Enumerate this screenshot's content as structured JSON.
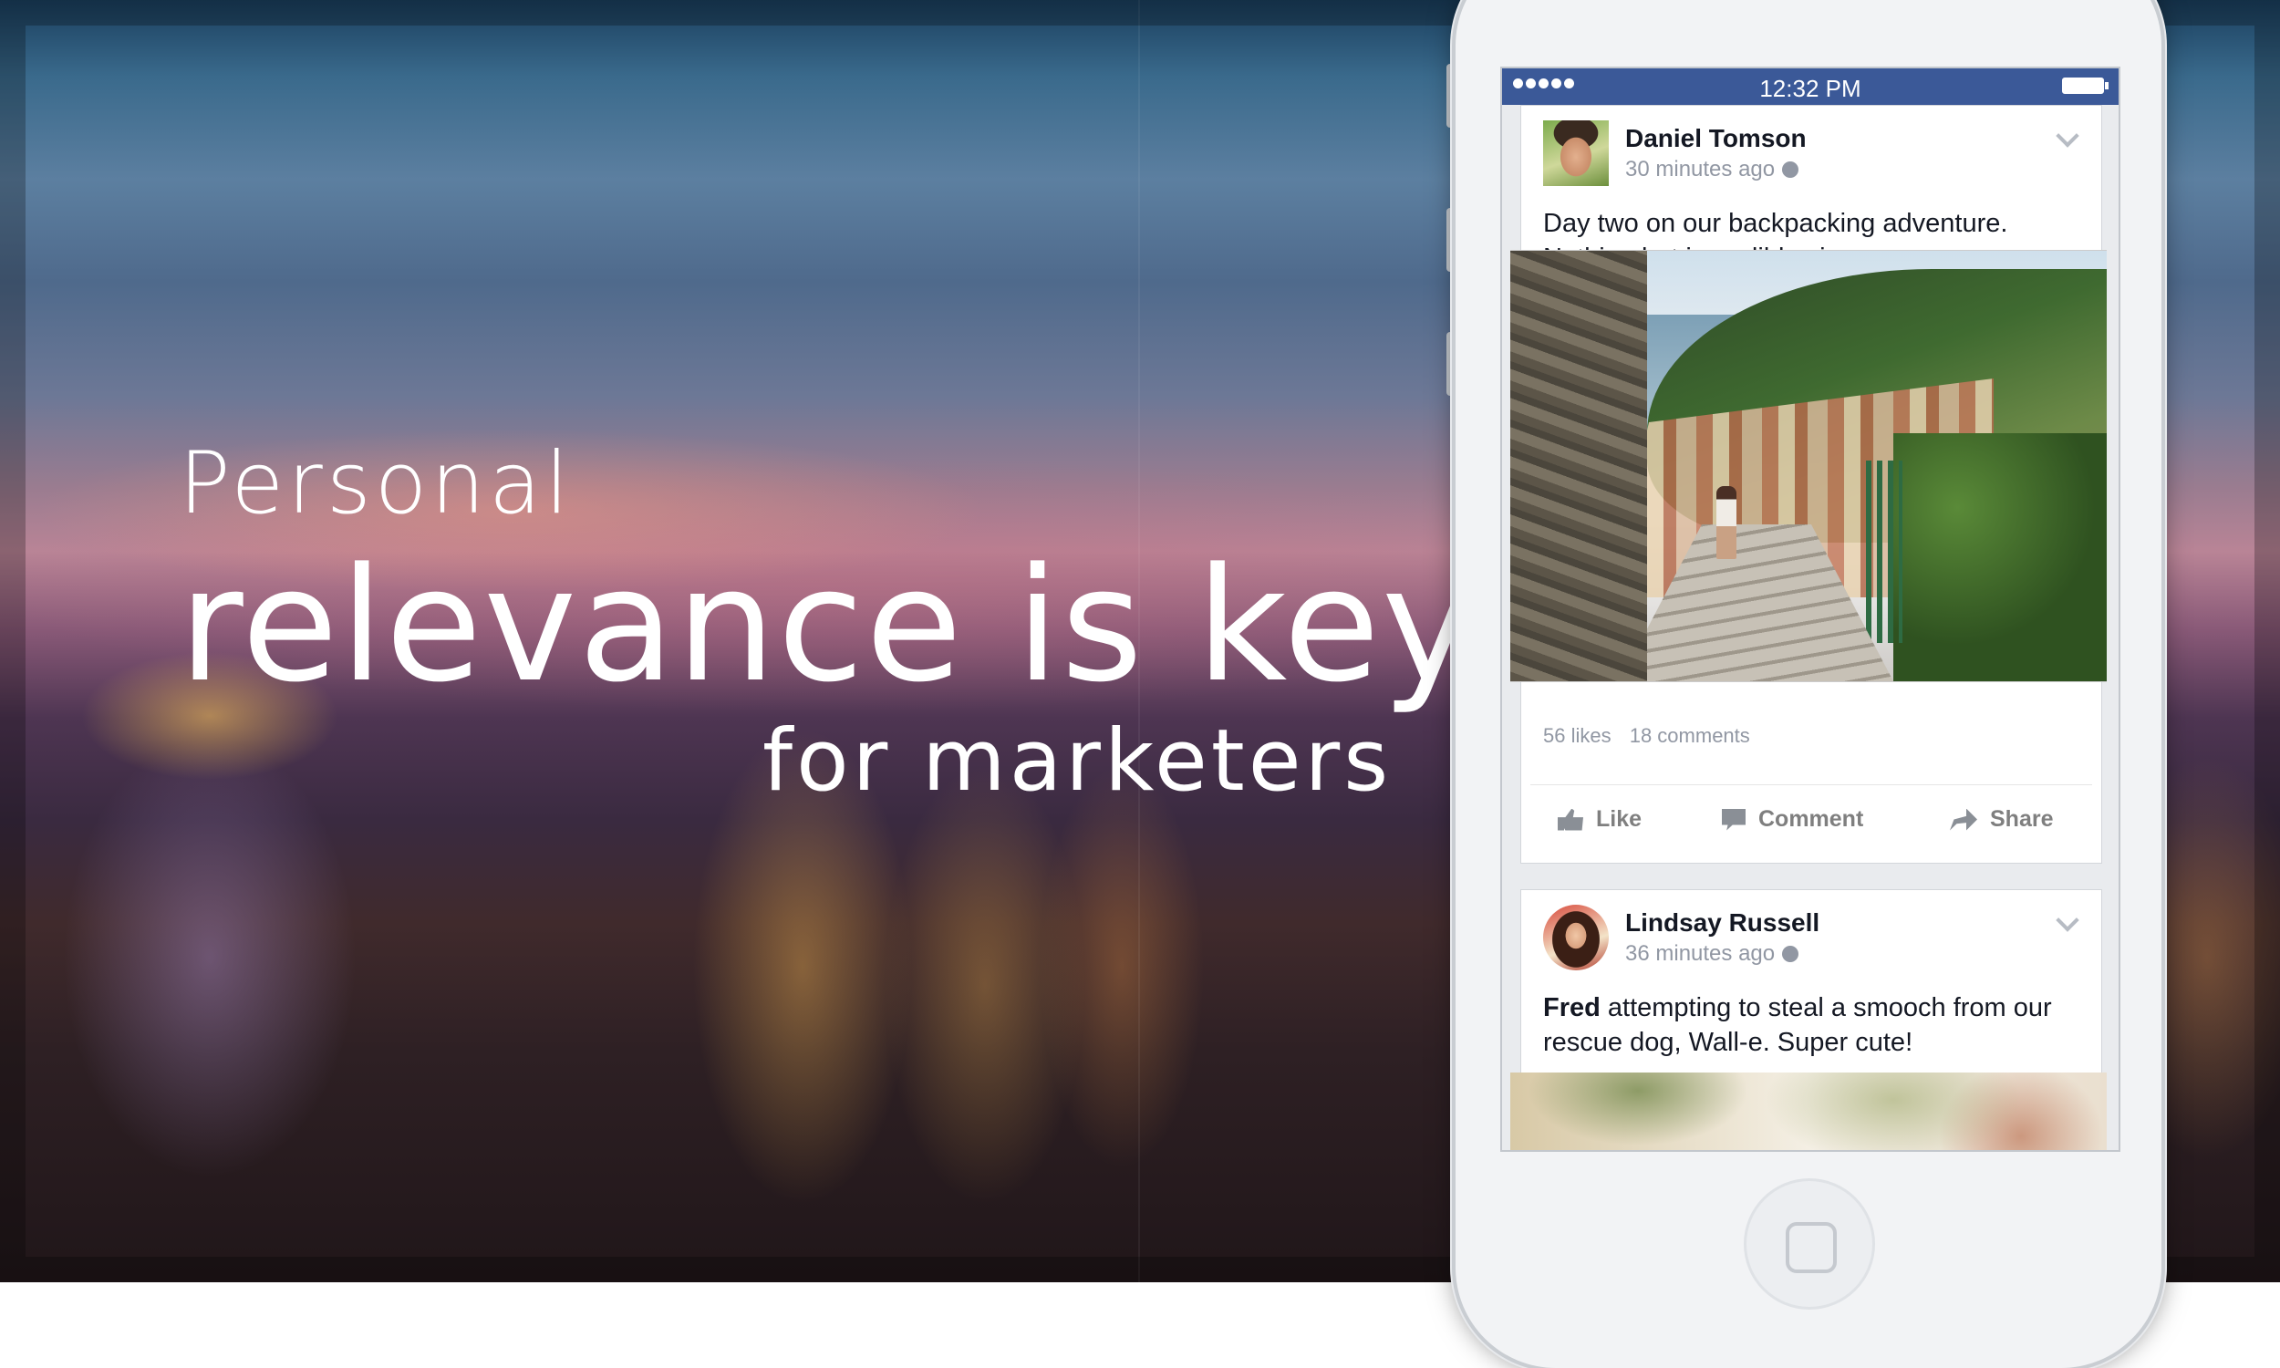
{
  "headline": {
    "line1": "Personal",
    "line2": "relevance is key",
    "line3": "for marketers"
  },
  "status_bar": {
    "time": "12:32 PM",
    "signal_dots": 5
  },
  "posts": [
    {
      "author": "Daniel Tomson",
      "time": "30 minutes ago",
      "text": "Day two on our backpacking adventure. Nothing but incredible views.",
      "likes": "56 likes",
      "comments": "18 comments"
    },
    {
      "author": "Lindsay Russell",
      "time": "36 minutes ago",
      "text_bold": "Fred",
      "text_rest": " attempting to steal a smooch from our rescue dog, Wall-e. Super cute!"
    }
  ],
  "actions": {
    "like": "Like",
    "comment": "Comment",
    "share": "Share"
  },
  "icons": {
    "like": "thumbs-up-icon",
    "comment": "speech-bubble-icon",
    "share": "share-arrow-icon",
    "privacy": "globe-icon",
    "menu": "chevron-down-icon"
  },
  "colors": {
    "facebook_blue": "#3b5998",
    "author_text": "#141823",
    "meta_text": "#9197a3"
  }
}
